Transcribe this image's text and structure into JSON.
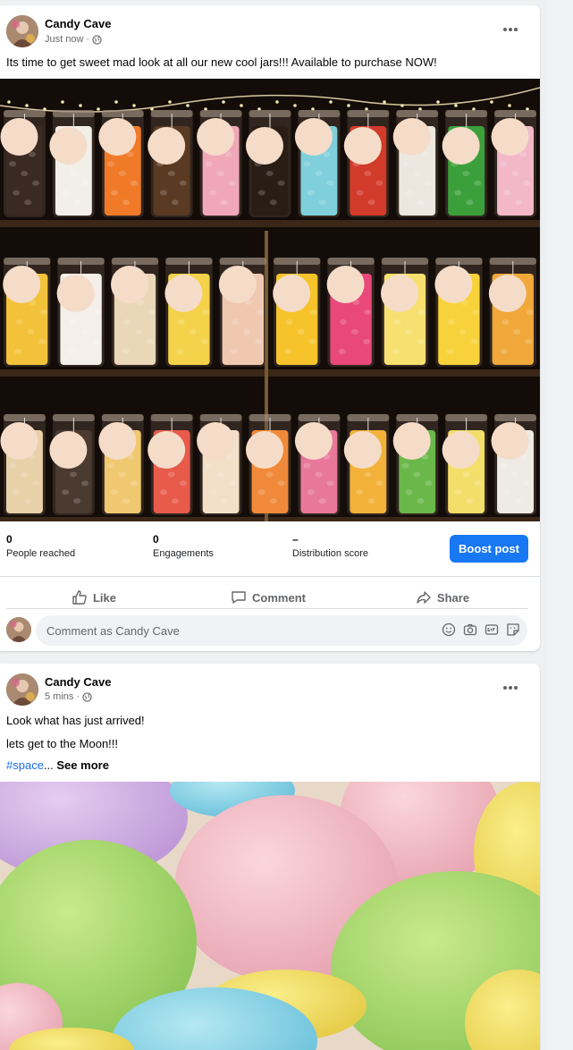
{
  "posts": [
    {
      "author": "Candy Cave",
      "time": "Just now",
      "text": "Its time to get sweet mad look at all our new cool jars!!! Available to purchase NOW!",
      "stats": [
        {
          "value": "0",
          "label": "People reached"
        },
        {
          "value": "0",
          "label": "Engagements"
        },
        {
          "value": "–",
          "label": "Distribution score"
        }
      ],
      "boost_label": "Boost post",
      "actions": {
        "like": "Like",
        "comment": "Comment",
        "share": "Share"
      },
      "comment_placeholder": "Comment as Candy Cave"
    },
    {
      "author": "Candy Cave",
      "time": "5 mins",
      "line1": "Look what has just arrived!",
      "line2": "lets get to the Moon!!!",
      "hashtag": "#space",
      "ellipsis": "...",
      "see_more": "See more"
    }
  ],
  "meta_separator": " · ",
  "colors": {
    "accent": "#1877f2",
    "hashtag": "#1b6fe0",
    "page_bg": "#eef0f2"
  },
  "icons": [
    "globe-icon",
    "more-options-icon",
    "like-icon",
    "comment-icon",
    "share-icon",
    "emoji-icon",
    "camera-icon",
    "gif-icon",
    "sticker-icon"
  ]
}
